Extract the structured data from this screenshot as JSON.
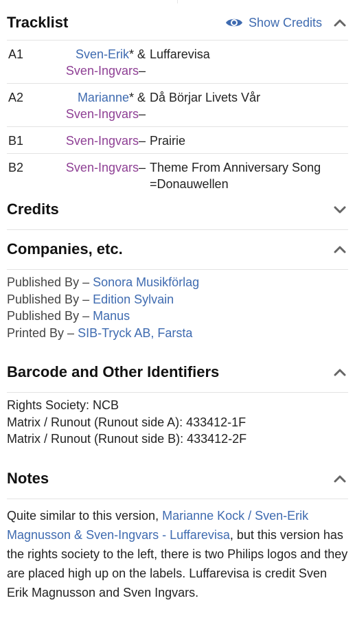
{
  "tracklist": {
    "title": "Tracklist",
    "show_credits": "Show Credits",
    "tracks": [
      {
        "pos": "A1",
        "artist1": "Sven-Erik",
        "artist1_suffix": "* &",
        "artist2": "Sven-Ingvars",
        "dash": "–",
        "title": "Luffarevisa"
      },
      {
        "pos": "A2",
        "artist1": "Marianne",
        "artist1_suffix": "* &",
        "artist2": "Sven-Ingvars",
        "dash": "–",
        "title": "Då Börjar Livets Vår"
      },
      {
        "pos": "B1",
        "artist1": "",
        "artist1_suffix": "",
        "artist2": "Sven-Ingvars",
        "dash": "–",
        "title": "Prairie"
      },
      {
        "pos": "B2",
        "artist1": "",
        "artist1_suffix": "",
        "artist2": "Sven-Ingvars",
        "dash": "–",
        "title": "Theme From Anniversary Song =Donauwellen"
      }
    ]
  },
  "credits": {
    "title": "Credits"
  },
  "companies": {
    "title": "Companies, etc.",
    "rows": [
      {
        "role": "Published By – ",
        "name": "Sonora Musikförlag"
      },
      {
        "role": "Published By – ",
        "name": "Edition Sylvain"
      },
      {
        "role": "Published By – ",
        "name": "Manus"
      },
      {
        "role": "Printed By – ",
        "name": "SIB-Tryck AB, Farsta"
      }
    ]
  },
  "barcode": {
    "title": "Barcode and Other Identifiers",
    "rows": [
      "Rights Society: NCB",
      "Matrix / Runout (Runout side A): 433412-1F",
      "Matrix / Runout (Runout side B): 433412-2F"
    ]
  },
  "notes": {
    "title": "Notes",
    "text_before": "Quite similar to this version, ",
    "link": "Marianne Kock / Sven-Erik Magnusson & Sven-Ingvars - Luffarevisa",
    "text_after": ", but this version has the rights society to the left, there is two Philips logos and they are placed high up on the labels. Luffarevisa is credit Sven Erik Magnusson and Sven Ingvars."
  },
  "colors": {
    "link": "#3f6bb0",
    "artist": "#8e3f94",
    "divider": "#e3e3e3"
  },
  "icons": {
    "eye": "eye-icon",
    "chevron_up": "chevron-up-icon",
    "chevron_down": "chevron-down-icon"
  }
}
